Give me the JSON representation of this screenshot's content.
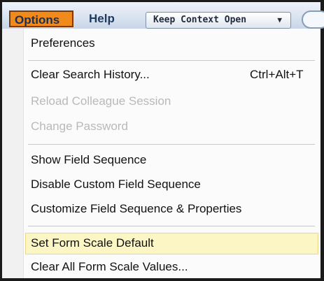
{
  "menubar": {
    "options_label": "Options",
    "help_label": "Help",
    "keep_context_label": "Keep Context Open",
    "keep_context_caret": "▼"
  },
  "menu": {
    "preferences": "Preferences",
    "clear_search_history": "Clear Search History...",
    "clear_search_history_shortcut": "Ctrl+Alt+T",
    "reload_colleague_session": "Reload Colleague Session",
    "change_password": "Change Password",
    "show_field_sequence": "Show Field Sequence",
    "disable_custom_field_sequence": "Disable Custom Field Sequence",
    "customize_field_sequence": "Customize Field Sequence & Properties",
    "set_form_scale_default": "Set Form Scale Default",
    "clear_all_form_scale_values": "Clear All Form Scale Values..."
  },
  "colors": {
    "options_highlight": "#f08a1c",
    "item_hover": "#fbf6c4",
    "disabled_text": "#b9b9b9"
  }
}
